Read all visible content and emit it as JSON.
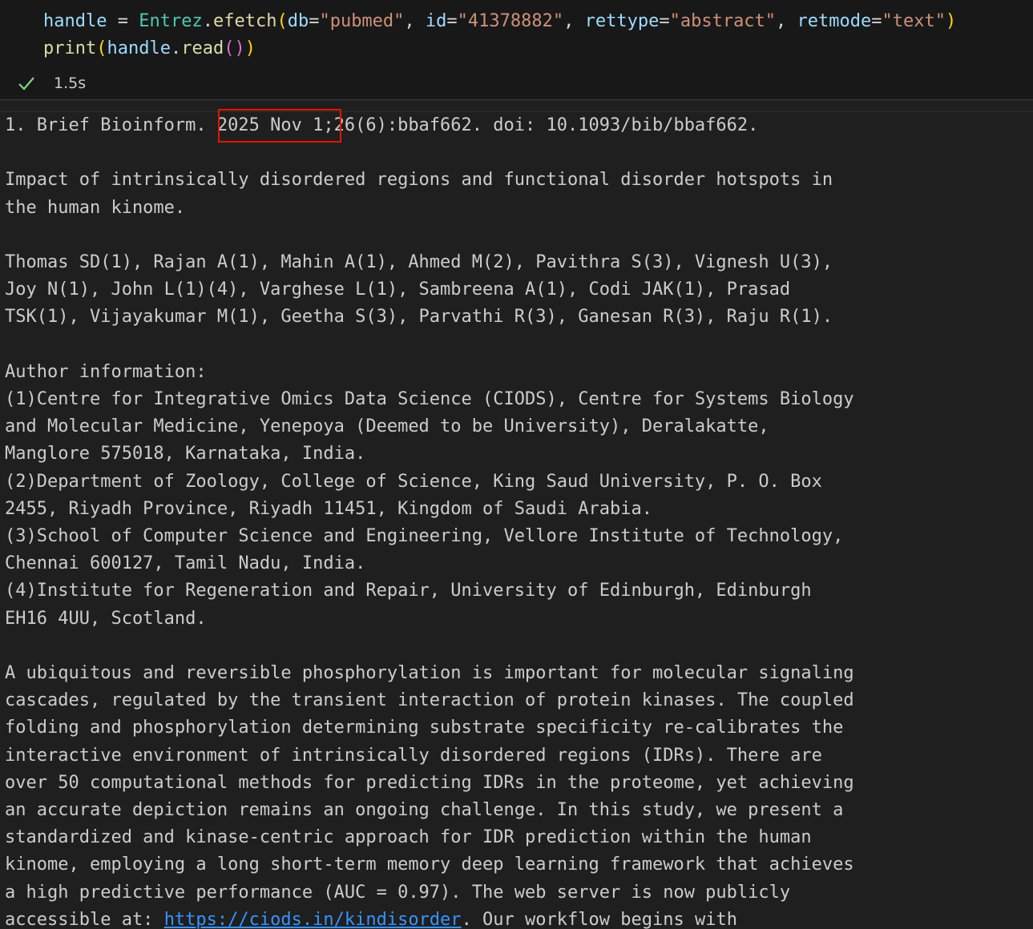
{
  "code": {
    "line1": {
      "t1": "handle",
      "t2": " = ",
      "t3": "Entrez",
      "t4": ".",
      "t5": "efetch",
      "t6": "(",
      "t7": "db",
      "t8": "=",
      "t9": "\"pubmed\"",
      "t10": ", ",
      "t11": "id",
      "t12": "=",
      "t13": "\"41378882\"",
      "t14": ", ",
      "t15": "rettype",
      "t16": "=",
      "t17": "\"abstract\"",
      "t18": ", ",
      "t19": "retmode",
      "t20": "=",
      "t21": "\"text\"",
      "t22": ")"
    },
    "line2": {
      "t1": "print",
      "t2": "(",
      "t3": "handle",
      "t4": ".",
      "t5": "read",
      "t6": "()",
      "t7": ")"
    }
  },
  "status": {
    "icon": "check-icon",
    "time": "1.5s",
    "color": "#89d185"
  },
  "highlight": {
    "color": "#e51400"
  },
  "output": {
    "lines": [
      "1. Brief Bioinform. 2025 Nov 1;26(6):bbaf662. doi: 10.1093/bib/bbaf662.",
      "",
      "Impact of intrinsically disordered regions and functional disorder hotspots in",
      "the human kinome.",
      "",
      "Thomas SD(1), Rajan A(1), Mahin A(1), Ahmed M(2), Pavithra S(3), Vignesh U(3),",
      "Joy N(1), John L(1)(4), Varghese L(1), Sambreena A(1), Codi JAK(1), Prasad",
      "TSK(1), Vijayakumar M(1), Geetha S(3), Parvathi R(3), Ganesan R(3), Raju R(1).",
      "",
      "Author information:",
      "(1)Centre for Integrative Omics Data Science (CIODS), Centre for Systems Biology",
      "and Molecular Medicine, Yenepoya (Deemed to be University), Deralakatte,",
      "Manglore 575018, Karnataka, India.",
      "(2)Department of Zoology, College of Science, King Saud University, P. O. Box",
      "2455, Riyadh Province, Riyadh 11451, Kingdom of Saudi Arabia.",
      "(3)School of Computer Science and Engineering, Vellore Institute of Technology,",
      "Chennai 600127, Tamil Nadu, India.",
      "(4)Institute for Regeneration and Repair, University of Edinburgh, Edinburgh",
      "EH16 4UU, Scotland.",
      "",
      "A ubiquitous and reversible phosphorylation is important for molecular signaling",
      "cascades, regulated by the transient interaction of protein kinases. The coupled",
      "folding and phosphorylation determining substrate specificity re-calibrates the",
      "interactive environment of intrinsically disordered regions (IDRs). There are",
      "over 50 computational methods for predicting IDRs in the proteome, yet achieving",
      "an accurate depiction remains an ongoing challenge. In this study, we present a",
      "standardized and kinase-centric approach for IDR prediction within the human",
      "kinome, employing a long short-term memory deep learning framework that achieves",
      "a high predictive performance (AUC = 0.97). The web server is now publicly"
    ],
    "last_line_prefix": "accessible at: ",
    "last_line_link": "https://ciods.in/kindisorder",
    "last_line_suffix": ". Our workflow begins with"
  }
}
